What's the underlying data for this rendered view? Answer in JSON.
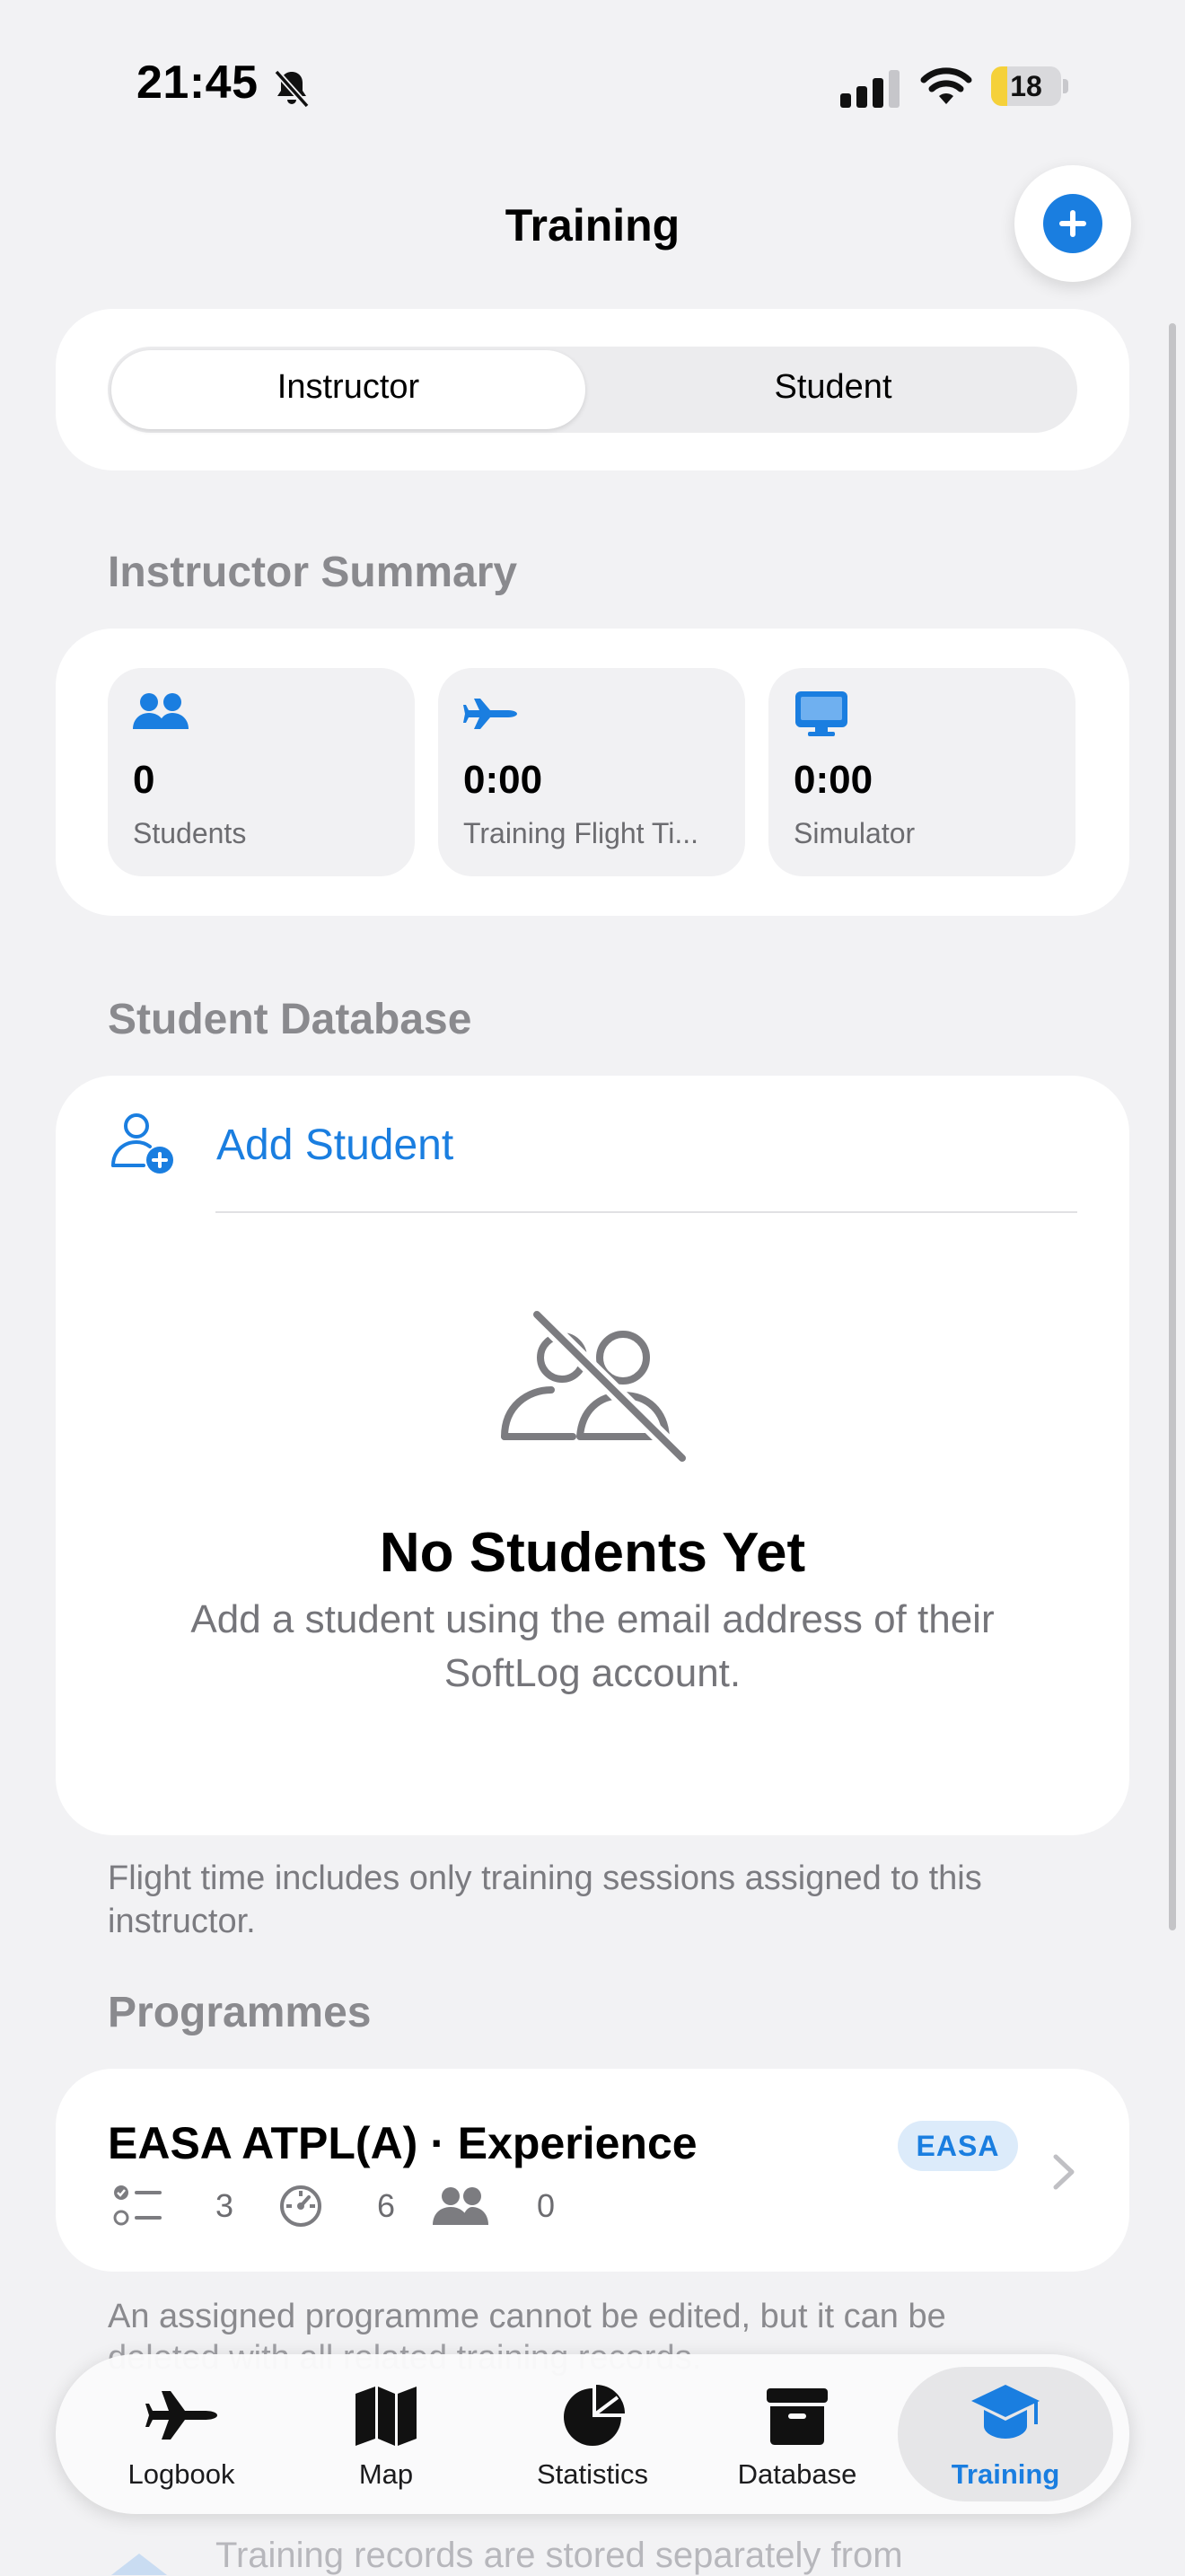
{
  "status_bar": {
    "time": "21:45",
    "battery": "18"
  },
  "header": {
    "title": "Training"
  },
  "segmented": {
    "options": [
      "Instructor",
      "Student"
    ],
    "selected": "Instructor"
  },
  "instructor_summary": {
    "title": "Instructor Summary",
    "tiles": [
      {
        "value": "0",
        "label": "Students",
        "icon": "people-icon"
      },
      {
        "value": "0:00",
        "label": "Training Flight Ti...",
        "icon": "airplane-icon"
      },
      {
        "value": "0:00",
        "label": "Simulator",
        "icon": "desktop-icon"
      }
    ]
  },
  "student_database": {
    "title": "Student Database",
    "add_label": "Add Student",
    "empty_title": "No Students Yet",
    "empty_desc": "Add a student using the email address of their SoftLog account."
  },
  "flight_time_note": "Flight time includes only training sessions assigned to this instructor.",
  "programmes": {
    "title": "Programmes",
    "items": [
      {
        "title": "EASA ATPL(A) · Experience",
        "badge": "EASA",
        "tasks": "3",
        "sessions": "6",
        "students": "0"
      }
    ],
    "note": "An assigned programme cannot be edited, but it can be",
    "note_hidden": "deleted with all related training records.",
    "records_note": "Training records are stored separately from"
  },
  "tab_bar": {
    "tabs": [
      {
        "label": "Logbook",
        "icon": "airplane-icon"
      },
      {
        "label": "Map",
        "icon": "map-icon"
      },
      {
        "label": "Statistics",
        "icon": "pie-chart-icon"
      },
      {
        "label": "Database",
        "icon": "archive-box-icon"
      },
      {
        "label": "Training",
        "icon": "graduation-cap-icon"
      }
    ],
    "active": "Training"
  },
  "colors": {
    "accent": "#1a7ee0",
    "background": "#f2f2f4",
    "badge_bg": "#dcebfa",
    "battery": "#f5d13a"
  }
}
